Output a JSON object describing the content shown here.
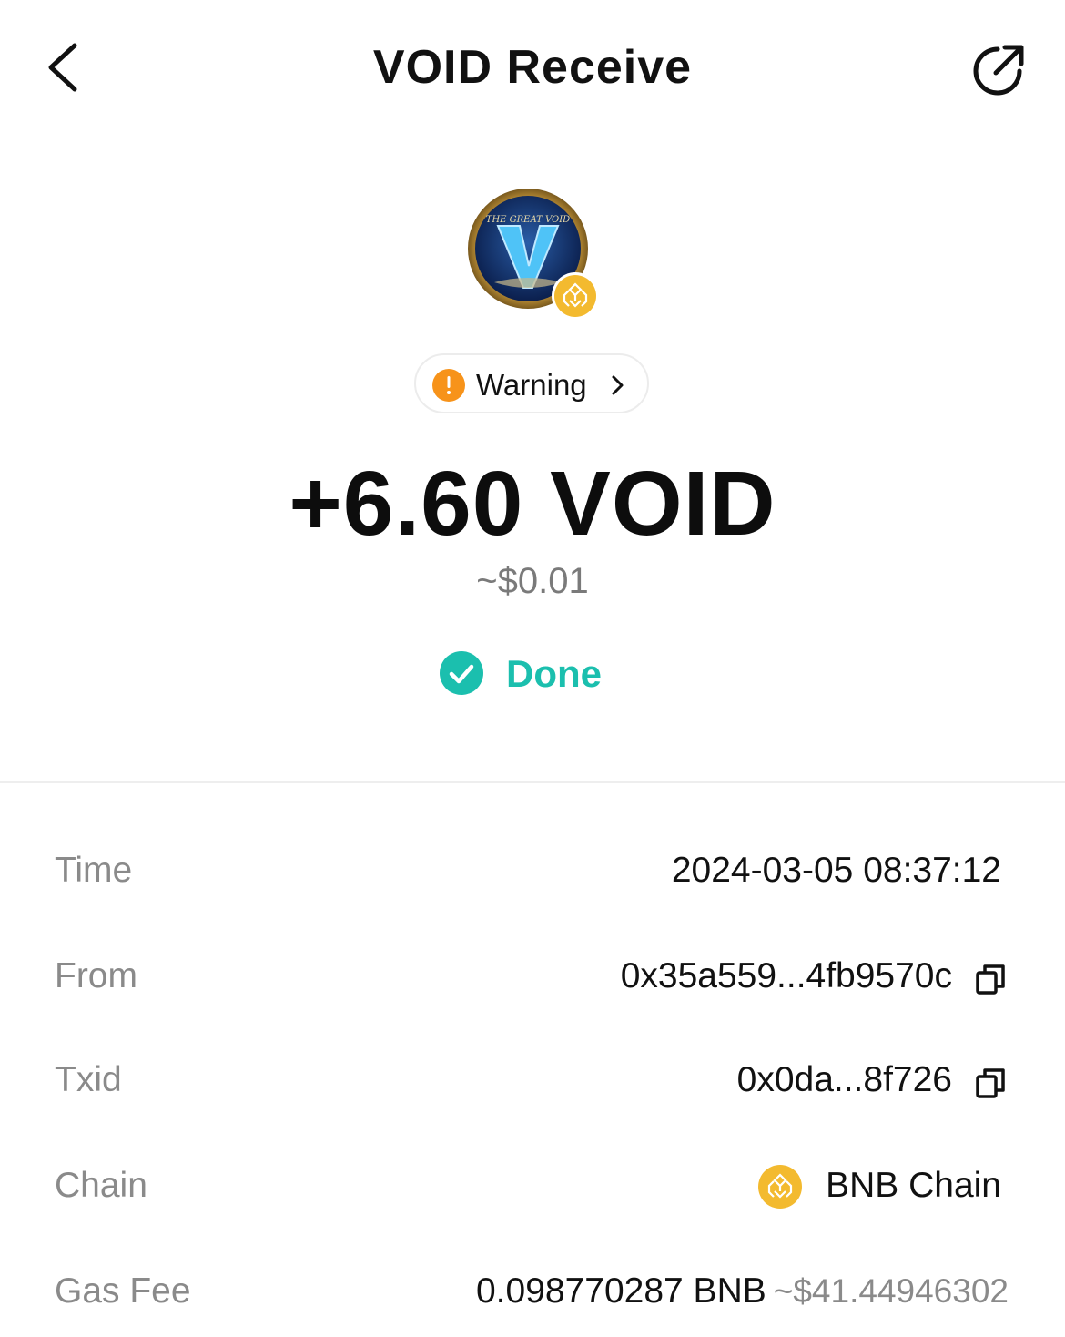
{
  "header": {
    "title": "VOID Receive",
    "back_icon": "chevron-left-icon",
    "share_icon": "external-link-icon"
  },
  "token": {
    "logo_name": "void-token-logo",
    "logo_text": "THE GREAT VOID",
    "chain_badge": "bnb-chain-badge"
  },
  "warning": {
    "label": "Warning",
    "color": "#f7931a"
  },
  "amount": "+6.60 VOID",
  "fiat_value": "~$0.01",
  "status": {
    "label": "Done",
    "color": "#1bbfae"
  },
  "details": {
    "time": {
      "label": "Time",
      "value": "2024-03-05 08:37:12"
    },
    "from": {
      "label": "From",
      "value": "0x35a559...4fb9570c"
    },
    "txid": {
      "label": "Txid",
      "value": "0x0da...8f726"
    },
    "chain": {
      "label": "Chain",
      "value": "BNB Chain"
    },
    "gas_fee": {
      "label": "Gas Fee",
      "value": "0.098770287 BNB",
      "fiat": "~$41.44946302"
    }
  },
  "colors": {
    "bnb": "#f3ba2f",
    "muted": "#8a8a8a"
  }
}
